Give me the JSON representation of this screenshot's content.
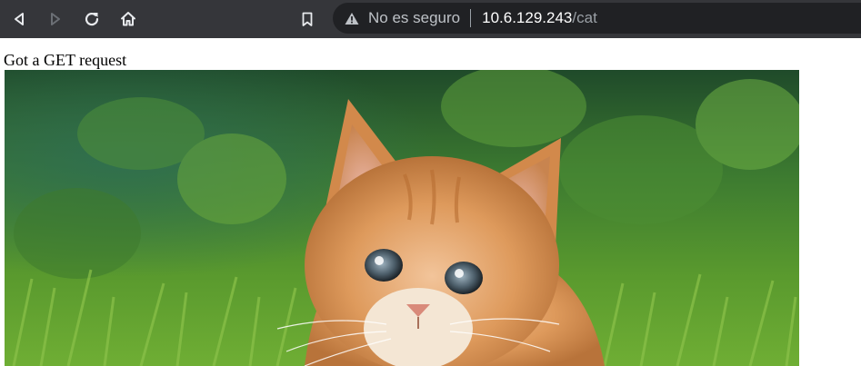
{
  "browser": {
    "security_label": "No es seguro",
    "url_host": "10.6.129.243",
    "url_path": "/cat",
    "icons": {
      "back": "back-arrow-icon",
      "forward": "forward-arrow-icon",
      "reload": "reload-icon",
      "home": "home-icon",
      "bookmark": "bookmark-icon",
      "warning": "warning-triangle-icon"
    }
  },
  "page": {
    "message": "Got a GET request",
    "image_subject": "orange kitten in grass"
  },
  "colors": {
    "toolbar_bg": "#35363a",
    "omnibox_bg": "#202124",
    "icon_color": "#e8eaed",
    "disabled_icon": "#6b6f75"
  }
}
